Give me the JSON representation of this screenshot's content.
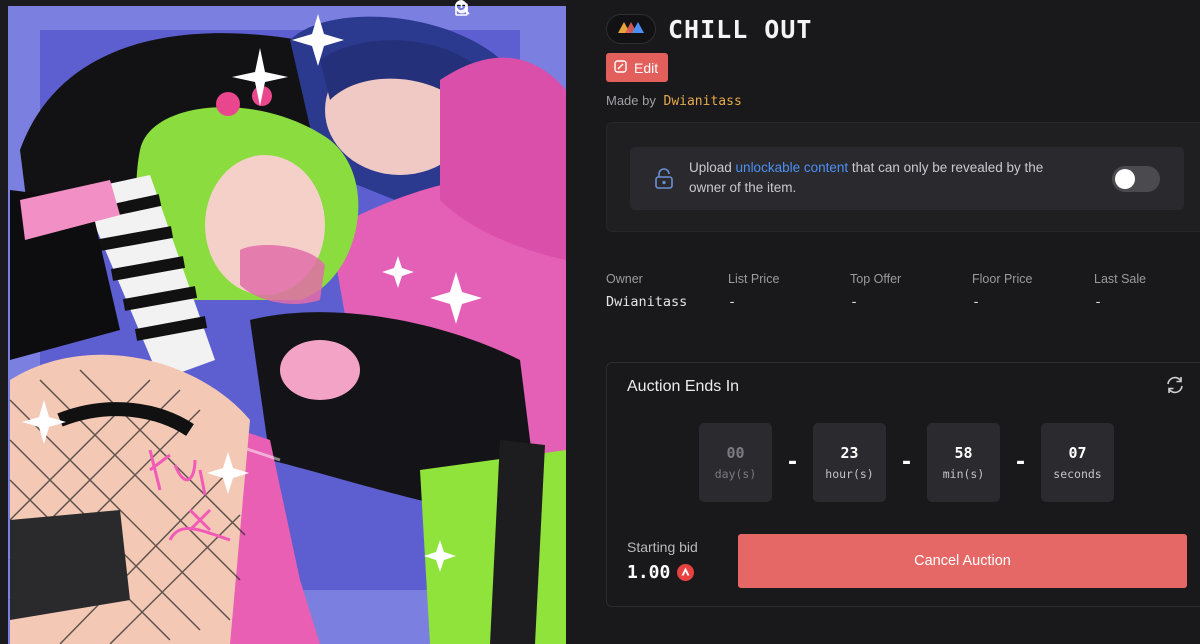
{
  "colors": {
    "accent": "#e25f5c",
    "creator": "#e7a94b",
    "link": "#4d8ff2",
    "panel_bg": "#19191b"
  },
  "artwork": {
    "icons": [
      "rotate-icon",
      "zoom-icon",
      "share-icon"
    ],
    "signature": "KUKI x SARA"
  },
  "item": {
    "title": "CHILL OUT",
    "chain_icon": "triangle-chain-icon"
  },
  "actions": {
    "edit_label": "Edit",
    "cancel_auction_label": "Cancel Auction"
  },
  "creator": {
    "prefix": "Made by",
    "name": "Dwianitass"
  },
  "unlockable": {
    "text_before": "Upload ",
    "link_text": "unlockable content",
    "text_after": " that can only be revealed by the owner of the item.",
    "enabled": false
  },
  "stats": [
    {
      "label": "Owner",
      "value": "Dwianitass"
    },
    {
      "label": "List Price",
      "value": "-"
    },
    {
      "label": "Top Offer",
      "value": "-"
    },
    {
      "label": "Floor Price",
      "value": "-"
    },
    {
      "label": "Last Sale",
      "value": "-"
    }
  ],
  "auction": {
    "title": "Auction Ends In",
    "countdown": [
      {
        "value": "00",
        "unit": "day(s)"
      },
      {
        "value": "23",
        "unit": "hour(s)"
      },
      {
        "value": "58",
        "unit": "min(s)"
      },
      {
        "value": "07",
        "unit": "seconds"
      }
    ],
    "separator": "-",
    "starting_bid_label": "Starting bid",
    "starting_bid_value": "1.00",
    "currency_icon": "avax-icon"
  }
}
